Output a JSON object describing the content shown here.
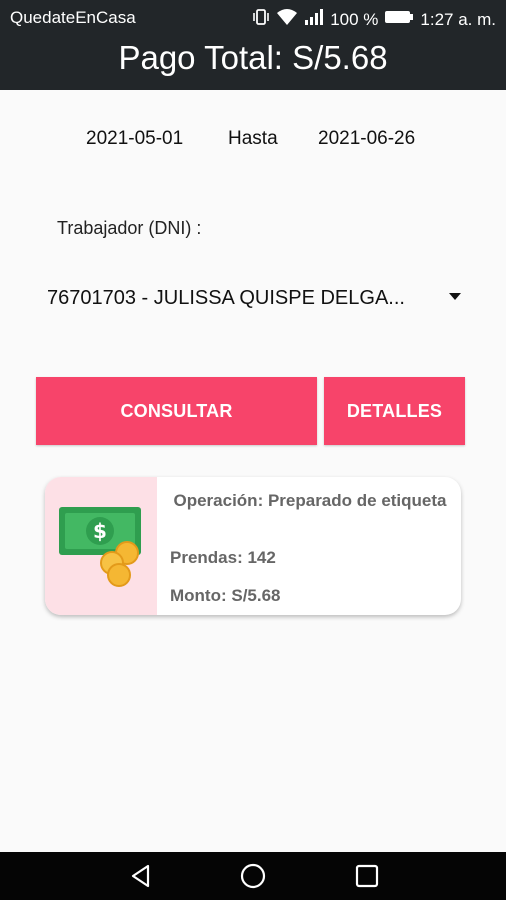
{
  "status_bar": {
    "app_name": "QuedateEnCasa",
    "battery": "100 %",
    "time": "1:27 a. m."
  },
  "app_bar": {
    "title": "Pago Total: S/5.68"
  },
  "date_range": {
    "from": "2021-05-01",
    "separator": "Hasta",
    "to": "2021-06-26"
  },
  "worker": {
    "label": "Trabajador (DNI) :",
    "selected": "76701703 - JULISSA QUISPE DELGA..."
  },
  "buttons": {
    "consultar": "CONSULTAR",
    "detalles": "DETALLES"
  },
  "result_card": {
    "operation": "Operación: Preparado de etiqueta",
    "prendas": "Prendas: 142",
    "monto": "Monto: S/5.68"
  },
  "colors": {
    "accent": "#f7446a",
    "dark_bar": "#222629",
    "card_side": "#fde0e6"
  },
  "icons": [
    "vibrate-icon",
    "wifi-icon",
    "signal-icon",
    "battery-icon",
    "money-icon",
    "back-icon",
    "home-icon",
    "recents-icon"
  ]
}
